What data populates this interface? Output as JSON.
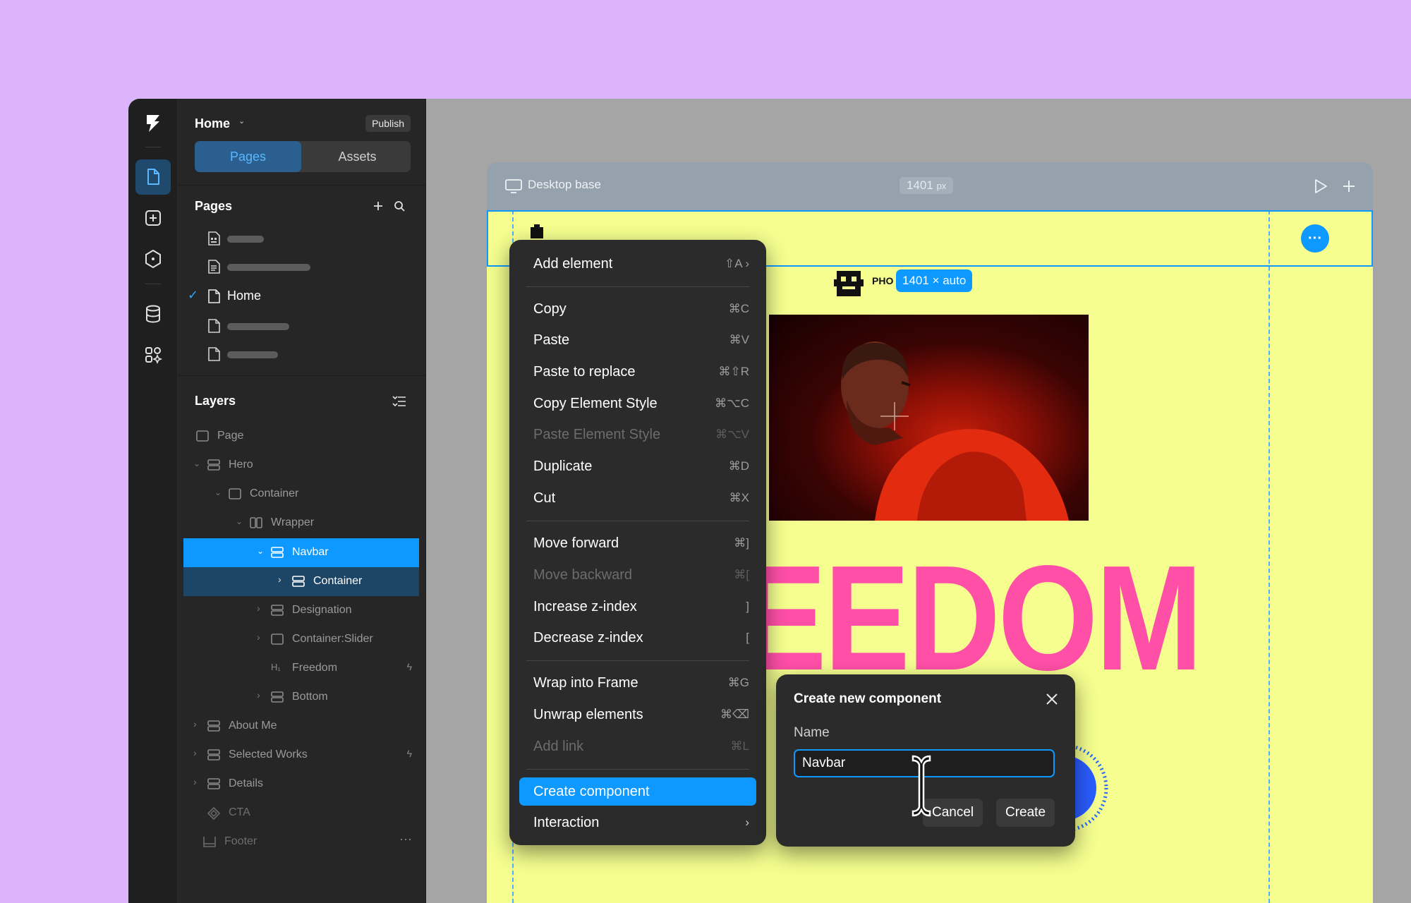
{
  "site": {
    "title": "Home",
    "publish_label": "Publish"
  },
  "tabs": [
    {
      "label": "Pages"
    },
    {
      "label": "Assets"
    }
  ],
  "pages_section": {
    "title": "Pages",
    "current_page": "Home"
  },
  "layers_section": {
    "title": "Layers",
    "items": [
      {
        "label": "Page"
      },
      {
        "label": "Hero"
      },
      {
        "label": "Container"
      },
      {
        "label": "Wrapper"
      },
      {
        "label": "Navbar"
      },
      {
        "label": "Container"
      },
      {
        "label": "Designation"
      },
      {
        "label": "Container:Slider"
      },
      {
        "label": "Freedom"
      },
      {
        "label": "Bottom"
      },
      {
        "label": "About Me"
      },
      {
        "label": "Selected Works"
      },
      {
        "label": "Details"
      },
      {
        "label": "CTA"
      },
      {
        "label": "Footer"
      }
    ]
  },
  "canvas": {
    "frame_label": "Desktop base",
    "frame_width_value": "1401",
    "frame_width_unit": "px",
    "size_badge": "1401 × auto",
    "logo_text": "PHO",
    "hero_text": "EEDOM"
  },
  "context_menu": {
    "items": [
      {
        "label": "Add element",
        "shortcut": "⇧A ›"
      },
      {
        "label": "Copy",
        "shortcut": "⌘C"
      },
      {
        "label": "Paste",
        "shortcut": "⌘V"
      },
      {
        "label": "Paste to replace",
        "shortcut": "⌘⇧R"
      },
      {
        "label": "Copy Element Style",
        "shortcut": "⌘⌥C"
      },
      {
        "label": "Paste Element Style",
        "shortcut": "⌘⌥V"
      },
      {
        "label": "Duplicate",
        "shortcut": "⌘D"
      },
      {
        "label": "Cut",
        "shortcut": "⌘X"
      },
      {
        "label": "Move forward",
        "shortcut": "⌘]"
      },
      {
        "label": "Move backward",
        "shortcut": "⌘["
      },
      {
        "label": "Increase z-index",
        "shortcut": "]"
      },
      {
        "label": "Decrease z-index",
        "shortcut": "["
      },
      {
        "label": "Wrap into Frame",
        "shortcut": "⌘G"
      },
      {
        "label": "Unwrap elements",
        "shortcut": "⌘⌫"
      },
      {
        "label": "Add link",
        "shortcut": "⌘L"
      },
      {
        "label": "Create component",
        "shortcut": ""
      },
      {
        "label": "Interaction",
        "shortcut": "›"
      }
    ]
  },
  "dialog": {
    "title": "Create new component",
    "name_label": "Name",
    "name_value": "Navbar",
    "cancel_label": "Cancel",
    "create_label": "Create"
  },
  "colors": {
    "accent": "#0d99ff",
    "background": "#dcb4fc",
    "canvas_page": "#f5fe8f",
    "hero_pink": "#ff4fa7"
  }
}
